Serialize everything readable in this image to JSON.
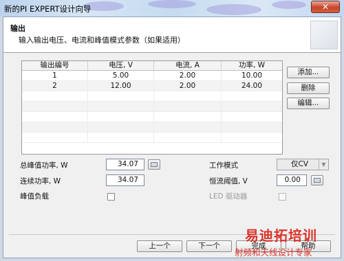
{
  "window": {
    "title": "新的PI EXPERT设计向导",
    "close_label": "✕"
  },
  "header": {
    "title": "输出",
    "subtitle": "输入输出电压、电流和峰值模式参数（如果适用）"
  },
  "table": {
    "columns": [
      "输出编号",
      "电压, V",
      "电流, A",
      "功率, W"
    ],
    "rows": [
      [
        "1",
        "5.00",
        "2.00",
        "10.00"
      ],
      [
        "2",
        "12.00",
        "2.00",
        "24.00"
      ]
    ]
  },
  "buttons": {
    "add": "添加...",
    "delete": "删除",
    "edit": "编辑..."
  },
  "form": {
    "total_peak_power_label": "总峰值功率, W",
    "total_peak_power_value": "34.07",
    "continuous_power_label": "连续功率, W",
    "continuous_power_value": "34.07",
    "peak_load_label": "峰值负载",
    "work_mode_label": "工作模式",
    "work_mode_value": "仅CV",
    "cc_threshold_label": "恒流阈值, V",
    "cc_threshold_value": "0.00",
    "led_driver_label": "LED 驱动器"
  },
  "footer": {
    "prev": "上一个",
    "next": "下一个",
    "finish": "完成",
    "help": "帮助"
  },
  "watermark": {
    "line1": "易迪拓培训",
    "line2": "射频和天线设计专家"
  }
}
